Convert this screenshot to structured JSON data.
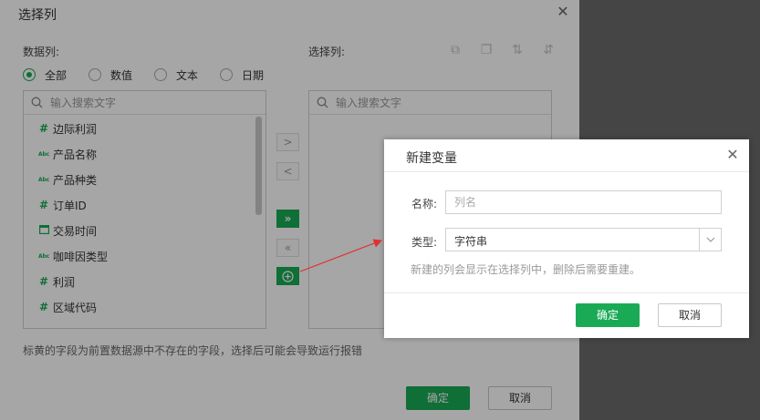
{
  "main_dialog": {
    "title": "选择列",
    "data_columns_label": "数据列:",
    "selected_columns_label": "选择列:",
    "filters": [
      {
        "label": "全部",
        "checked": true
      },
      {
        "label": "数值",
        "checked": false
      },
      {
        "label": "文本",
        "checked": false
      },
      {
        "label": "日期",
        "checked": false
      }
    ],
    "search_placeholder": "输入搜索文字",
    "columns": [
      {
        "type": "number",
        "label": "边际利润"
      },
      {
        "type": "text",
        "label": "产品名称"
      },
      {
        "type": "text",
        "label": "产品种类"
      },
      {
        "type": "number",
        "label": "订单ID"
      },
      {
        "type": "date",
        "label": "交易时间"
      },
      {
        "type": "text",
        "label": "咖啡因类型"
      },
      {
        "type": "number",
        "label": "利润"
      },
      {
        "type": "number",
        "label": "区域代码"
      }
    ],
    "selected_search_placeholder": "输入搜索文字",
    "hint": "标黄的字段为前置数据源中不存在的字段，选择后可能会导致运行报错",
    "ok_label": "确定",
    "cancel_label": "取消",
    "type_icon_number": "#",
    "type_icon_text": "Abc"
  },
  "new_variable_dialog": {
    "title": "新建变量",
    "name_label": "名称:",
    "name_placeholder": "列名",
    "type_label": "类型:",
    "type_value": "字符串",
    "note": "新建的列会显示在选择列中，删除后需要重建。",
    "ok_label": "确定",
    "cancel_label": "取消"
  },
  "colors": {
    "accent": "#1aaa55",
    "annotation_arrow": "#e03030"
  }
}
